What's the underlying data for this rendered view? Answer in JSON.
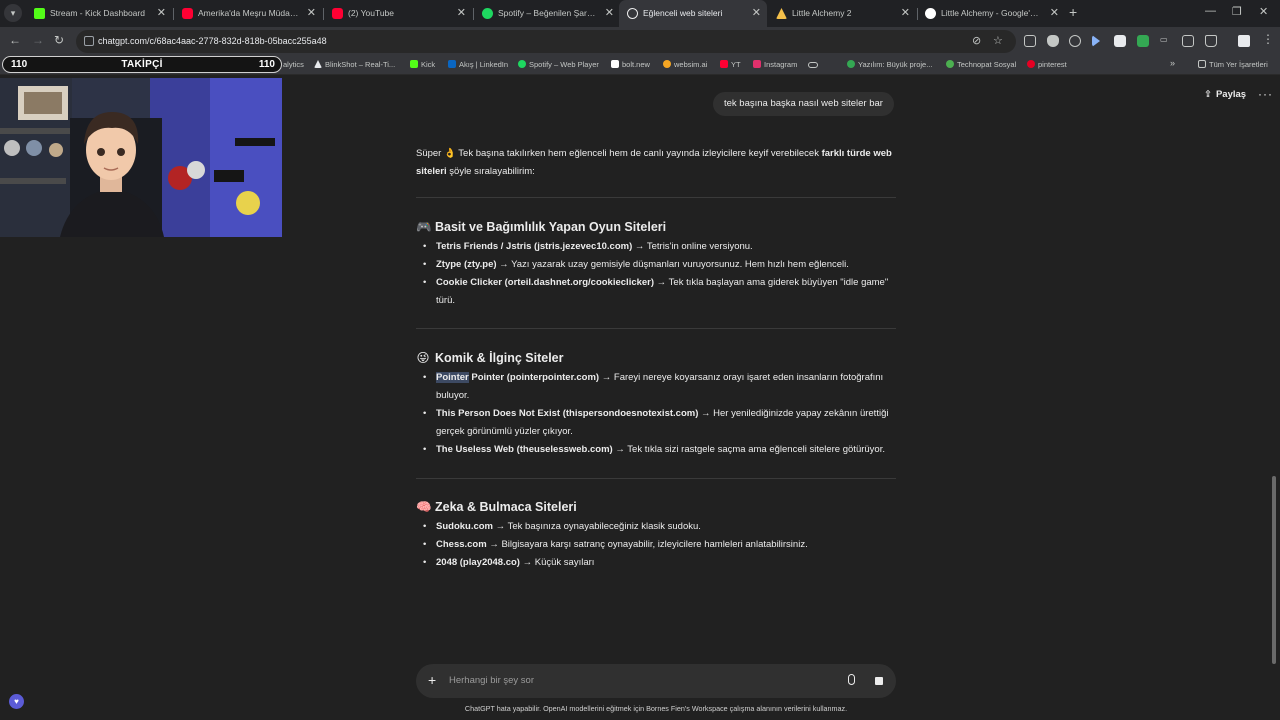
{
  "browser": {
    "tabs": [
      {
        "title": "Stream - Kick Dashboard",
        "icon": "kick-icon",
        "color": "#53fc18"
      },
      {
        "title": "Amerika'da Meşru Müdafaa - Y",
        "icon": "youtube-icon",
        "color": "#ff0033"
      },
      {
        "title": "(2) YouTube",
        "icon": "youtube-icon",
        "color": "#ff0033"
      },
      {
        "title": "Spotify – Beğenilen Şarkılar",
        "icon": "spotify-icon",
        "color": "#1ed760"
      },
      {
        "title": "Eğlenceli web siteleri",
        "icon": "chatgpt-icon",
        "color": "#ececec"
      },
      {
        "title": "Little Alchemy 2",
        "icon": "alchemy-icon",
        "color": "#f4c04a"
      },
      {
        "title": "Little Alchemy - Google'da Ara",
        "icon": "google-icon",
        "color": "#ffffff"
      }
    ],
    "url": "chatgpt.com/c/68ac4aac-2778-832d-818b-05bacc255a48",
    "bookmarks": [
      {
        "label": "alytics",
        "color": "#9aa0a6"
      },
      {
        "label": "BlinkShot – Real-Ti...",
        "color": "#e8eaed"
      },
      {
        "label": "Kick",
        "color": "#53fc18"
      },
      {
        "label": "Akış | LinkedIn",
        "color": "#0a66c2"
      },
      {
        "label": "Spotify – Web Player",
        "color": "#1ed760"
      },
      {
        "label": "bolt.new",
        "color": "#ffffff"
      },
      {
        "label": "websim.ai",
        "color": "#f5a623"
      },
      {
        "label": "YT",
        "color": "#ff0033"
      },
      {
        "label": "Instagram",
        "color": "#e1306c"
      },
      {
        "label": "",
        "color": "#c4c7c5"
      },
      {
        "label": "Yazılım: Büyük proje...",
        "color": "#34a853"
      },
      {
        "label": "Technopat Sosyal",
        "color": "#4caf50"
      },
      {
        "label": "pinterest",
        "color": "#e60023"
      }
    ],
    "all_bookmarks": "Tüm Yer İşaretleri"
  },
  "overlay": {
    "followers_left": "110",
    "followers_label": "TAKİPÇİ",
    "followers_right": "110"
  },
  "chat": {
    "share_label": "Paylaş",
    "user_message": "tek başına başka nasıl web siteler bar",
    "intro_pre": "Süper 👌 Tek başına takılırken hem eğlenceli hem de canlı yayında izleyicilere keyif verebilecek ",
    "intro_bold": "farklı türde web siteleri",
    "intro_post": " şöyle sıralayabilirim:",
    "sections": [
      {
        "emoji": "🎮",
        "title": "Basit ve Bağımlılık Yapan Oyun Siteleri",
        "items": [
          {
            "bold": "Tetris Friends / Jstris (jstris.jezevec10.com)",
            "text": " → Tetris'in online versiyonu."
          },
          {
            "bold": "Ztype (zty.pe)",
            "text": " → Yazı yazarak uzay gemisiyle düşmanları vuruyorsunuz. Hem hızlı hem eğlenceli."
          },
          {
            "bold": "Cookie Clicker (orteil.dashnet.org/cookieclicker)",
            "text": " → Tek tıkla başlayan ama giderek büyüyen \"idle game\" türü."
          }
        ]
      },
      {
        "emoji": "😜",
        "title": "Komik & İlginç Siteler",
        "items": [
          {
            "highlight": "Pointer",
            "bold": " Pointer (pointerpointer.com)",
            "text": " → Fareyi nereye koyarsanız orayı işaret eden insanların fotoğrafını buluyor."
          },
          {
            "bold": "This Person Does Not Exist (thispersondoesnotexist.com)",
            "text": " → Her yenilediğinizde yapay zekânın ürettiği gerçek görünümlü yüzler çıkıyor."
          },
          {
            "bold": "The Useless Web (theuselessweb.com)",
            "text": " → Tek tıkla sizi rastgele saçma ama eğlenceli sitelere götürüyor."
          }
        ]
      },
      {
        "emoji": "🧠",
        "title": "Zeka & Bulmaca Siteleri",
        "items": [
          {
            "bold": "Sudoku.com",
            "text": " → Tek başınıza oynayabileceğiniz klasik sudoku."
          },
          {
            "bold": "Chess.com",
            "text": " → Bilgisayara karşı satranç oynayabilir, izleyicilere hamleleri anlatabilirsiniz."
          },
          {
            "bold": "2048 (play2048.co)",
            "text": " → Küçük sayıları"
          }
        ]
      }
    ],
    "composer_placeholder": "Herhangi bir şey sor",
    "disclaimer": "ChatGPT hata yapabilir. OpenAI modellerini eğitmek için Bornes Fien's Workspace çalışma alanının verilerini kullanmaz."
  }
}
